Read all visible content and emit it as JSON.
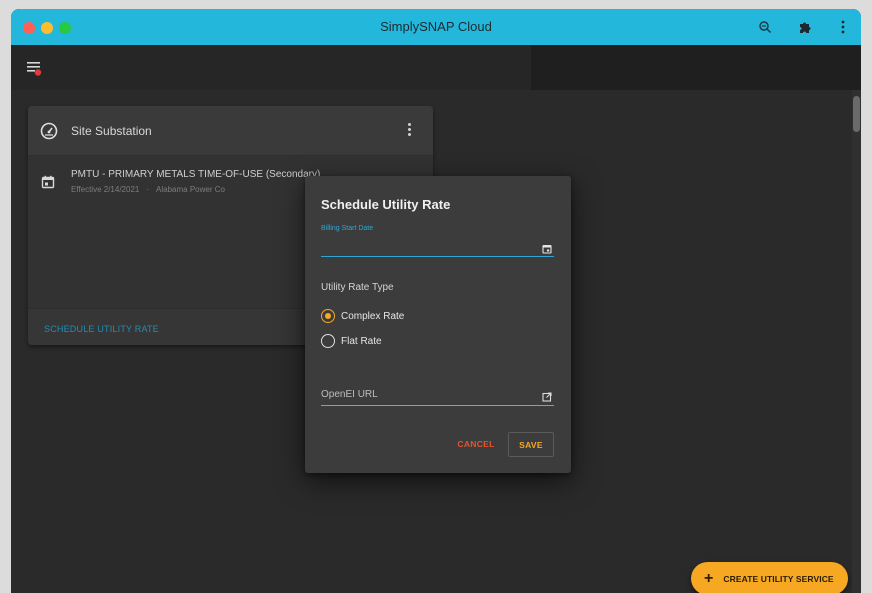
{
  "window": {
    "title": "SimplySNAP Cloud"
  },
  "toolbar": {
    "icons": [
      "zoom-icon",
      "puzzle-extension-icon",
      "more-vert-icon"
    ]
  },
  "appbar": {
    "menu_icon": "menu-with-badge-icon",
    "badge_color": "#e53935"
  },
  "site_card": {
    "title": "Site Substation",
    "icon": "gauge-icon",
    "rate": {
      "title": "PMTU - PRIMARY METALS TIME-OF-USE (Secondary)",
      "effective": "Effective 2/14/2021",
      "separator": "·",
      "provider": "Alabama Power Co",
      "icon": "calendar-icon"
    },
    "footer_link": "SCHEDULE UTILITY RATE"
  },
  "dialog": {
    "title": "Schedule Utility Rate",
    "billing_start_label": "Billing Start Date",
    "billing_start_value": "",
    "rate_type_label": "Utility Rate Type",
    "options": [
      {
        "label": "Complex Rate",
        "checked": true
      },
      {
        "label": "Flat Rate",
        "checked": false
      }
    ],
    "url_label": "OpenEI URL",
    "url_value": "",
    "cancel_label": "CANCEL",
    "save_label": "SAVE"
  },
  "fab": {
    "label": "CREATE UTILITY SERVICE",
    "plus": "+"
  },
  "colors": {
    "accent": "#f7a823",
    "link": "#1f8fb4",
    "titlebar": "#23b7dc",
    "cancel": "#e6532d"
  }
}
